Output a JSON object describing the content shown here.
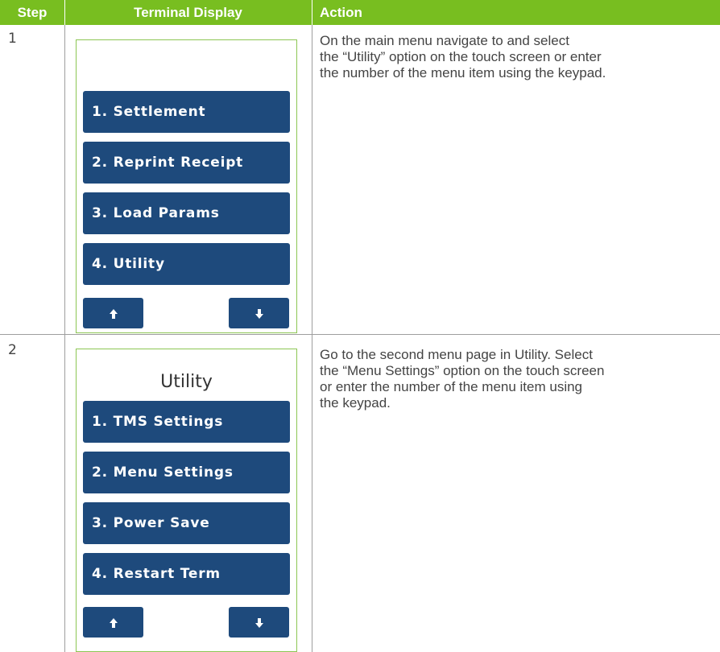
{
  "header": {
    "step": "Step",
    "terminal_display": "Terminal Display",
    "action": "Action"
  },
  "rows": [
    {
      "step": "1",
      "screen_title": "",
      "menu_items": [
        "1. Settlement",
        "2. Reprint Receipt",
        "3. Load Params",
        "4. Utility"
      ],
      "action_lines": [
        "On the main menu navigate to and select",
        "the “Utility” option on the touch screen or enter",
        "the number of the menu item using the keypad."
      ]
    },
    {
      "step": "2",
      "screen_title": "Utility",
      "menu_items": [
        "1. TMS Settings",
        "2. Menu Settings",
        "3. Power Save",
        "4. Restart Term"
      ],
      "action_lines": [
        "Go to the second menu page in Utility. Select",
        "the “Menu Settings” option on the touch screen",
        "or enter the number of the menu item using",
        "the keypad."
      ]
    }
  ],
  "icons": {
    "up": "arrow-up-icon",
    "down": "arrow-down-icon"
  },
  "colors": {
    "header_bg": "#78be20",
    "button_bg": "#1e4a7c",
    "screen_border": "#8cc653"
  }
}
